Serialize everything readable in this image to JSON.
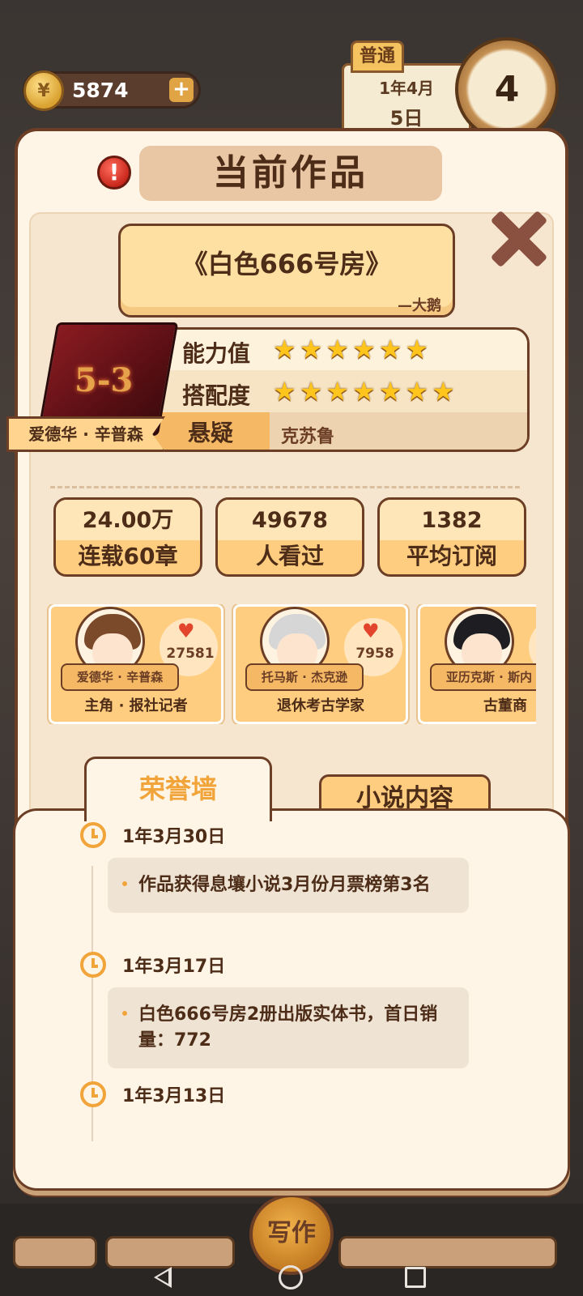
{
  "hud": {
    "coins": "5874",
    "coin_plus": "+",
    "mode": "普通",
    "calendar_year_month": "1年4月",
    "calendar_day": "5日",
    "clock_value": "4"
  },
  "modal": {
    "alert": "!",
    "title": "当前作品",
    "book": {
      "title": "《白色666号房》",
      "author": "—大鹅",
      "cover_mark": "5-3"
    },
    "stats": {
      "ability_label": "能力值",
      "ability_stars": 6,
      "match_label": "搭配度",
      "match_stars": 7,
      "genre": "悬疑",
      "sub_genre": "克苏鲁"
    },
    "protagonist_tag": "爱德华 · 辛普森",
    "metrics": [
      {
        "top": "24.00万",
        "bottom": "连载60章"
      },
      {
        "top": "49678",
        "bottom": "人看过"
      },
      {
        "top": "1382",
        "bottom": "平均订阅"
      }
    ],
    "characters": [
      {
        "name": "爱德华 · 辛普森",
        "fans": "27581",
        "role": "主角 · 报社记者",
        "hair_color": "#7a4a2a"
      },
      {
        "name": "托马斯 · 杰克逊",
        "fans": "7958",
        "role": "退休考古学家",
        "hair_color": "#d6d6d6"
      },
      {
        "name": "亚历克斯 · 斯内",
        "fans": "",
        "role": "古董商",
        "hair_color": "#1e1e22"
      }
    ],
    "tabs": {
      "honor": "荣誉墙",
      "content": "小说内容"
    },
    "timeline": [
      {
        "date": "1年3月30日",
        "text": "作品获得息壤小说3月份月票榜第3名"
      },
      {
        "date": "1年3月17日",
        "text": "白色666号房2册出版实体书，首日销量：772"
      },
      {
        "date": "1年3月13日",
        "text": ""
      }
    ]
  },
  "bottom": {
    "write_button": "写作"
  }
}
